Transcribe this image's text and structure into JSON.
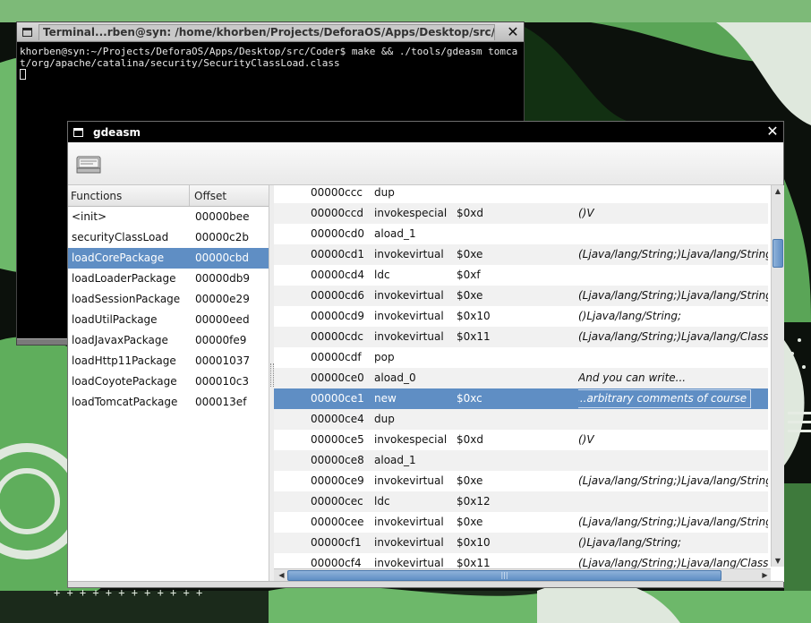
{
  "terminal": {
    "title": "Terminal...rben@syn: /home/khorben/Projects/DeforaOS/Apps/Desktop/src/Coder",
    "lines": [
      "khorben@syn:~/Projects/DeforaOS/Apps/Desktop/src/Coder$ make && ./tools/gdeasm tomcat/org/apache/catalina/security/SecurityClassLoad.class"
    ],
    "menu_icon": "window-menu-icon",
    "close_icon": "close-icon"
  },
  "gdeasm": {
    "title": "gdeasm",
    "toolbar": {
      "open_icon": "open-file-icon"
    },
    "functions": {
      "headers": {
        "name": "Functions",
        "offset": "Offset"
      },
      "rows": [
        {
          "name": "<init>",
          "offset": "00000bee"
        },
        {
          "name": "securityClassLoad",
          "offset": "00000c2b"
        },
        {
          "name": "loadCorePackage",
          "offset": "00000cbd"
        },
        {
          "name": "loadLoaderPackage",
          "offset": "00000db9"
        },
        {
          "name": "loadSessionPackage",
          "offset": "00000e29"
        },
        {
          "name": "loadUtilPackage",
          "offset": "00000eed"
        },
        {
          "name": "loadJavaxPackage",
          "offset": "00000fe9"
        },
        {
          "name": "loadHttp11Package",
          "offset": "00001037"
        },
        {
          "name": "loadCoyotePackage",
          "offset": "000010c3"
        },
        {
          "name": "loadTomcatPackage",
          "offset": "000013ef"
        }
      ],
      "selected_index": 2
    },
    "code": {
      "rows": [
        {
          "offset": "00000ccc",
          "op": "dup",
          "arg": "",
          "comment": ""
        },
        {
          "offset": "00000ccd",
          "op": "invokespecial",
          "arg": "$0xd",
          "comment": "()V"
        },
        {
          "offset": "00000cd0",
          "op": "aload_1",
          "arg": "",
          "comment": ""
        },
        {
          "offset": "00000cd1",
          "op": "invokevirtual",
          "arg": "$0xe",
          "comment": "(Ljava/lang/String;)Ljava/lang/StringBuilder;"
        },
        {
          "offset": "00000cd4",
          "op": "ldc",
          "arg": "$0xf",
          "comment": ""
        },
        {
          "offset": "00000cd6",
          "op": "invokevirtual",
          "arg": "$0xe",
          "comment": "(Ljava/lang/String;)Ljava/lang/StringBuilder;"
        },
        {
          "offset": "00000cd9",
          "op": "invokevirtual",
          "arg": "$0x10",
          "comment": "()Ljava/lang/String;"
        },
        {
          "offset": "00000cdc",
          "op": "invokevirtual",
          "arg": "$0x11",
          "comment": "(Ljava/lang/String;)Ljava/lang/Class;"
        },
        {
          "offset": "00000cdf",
          "op": "pop",
          "arg": "",
          "comment": ""
        },
        {
          "offset": "00000ce0",
          "op": "aload_0",
          "arg": "",
          "comment": "And you can write..."
        },
        {
          "offset": "00000ce1",
          "op": "new",
          "arg": "$0xc",
          "comment": "...arbitrary comments of course"
        },
        {
          "offset": "00000ce4",
          "op": "dup",
          "arg": "",
          "comment": ""
        },
        {
          "offset": "00000ce5",
          "op": "invokespecial",
          "arg": "$0xd",
          "comment": "()V"
        },
        {
          "offset": "00000ce8",
          "op": "aload_1",
          "arg": "",
          "comment": ""
        },
        {
          "offset": "00000ce9",
          "op": "invokevirtual",
          "arg": "$0xe",
          "comment": "(Ljava/lang/String;)Ljava/lang/StringBuilder;"
        },
        {
          "offset": "00000cec",
          "op": "ldc",
          "arg": "$0x12",
          "comment": ""
        },
        {
          "offset": "00000cee",
          "op": "invokevirtual",
          "arg": "$0xe",
          "comment": "(Ljava/lang/String;)Ljava/lang/StringBuilder;"
        },
        {
          "offset": "00000cf1",
          "op": "invokevirtual",
          "arg": "$0x10",
          "comment": "()Ljava/lang/String;"
        },
        {
          "offset": "00000cf4",
          "op": "invokevirtual",
          "arg": "$0x11",
          "comment": "(Ljava/lang/String;)Ljava/lang/Class;"
        }
      ],
      "selected_index": 10
    },
    "colors": {
      "selection": "#5f8ec4",
      "titlebar": "#000000"
    }
  }
}
